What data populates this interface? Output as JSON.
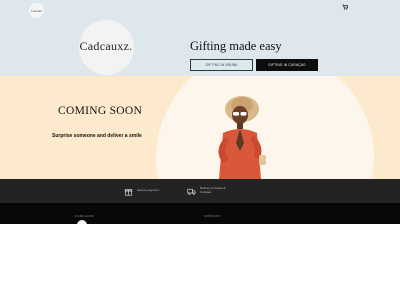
{
  "header": {
    "mini_logo_text": "Cadcaux",
    "cart_icon": "cart-icon",
    "logo_text": "Cadcauxz.",
    "tagline": "Gifting made easy",
    "buttons": {
      "primary_outline": "GIFTING IN ARUBA",
      "primary_filled": "GIFTING IN CURAÇAO"
    }
  },
  "hero": {
    "headline": "COMING SOON",
    "subheadline": "Surprise someone and deliver a smile"
  },
  "features": [
    {
      "icon": "gift-box-icon",
      "label": "Secure payment"
    },
    {
      "icon": "delivery-truck-icon",
      "label": "Delivery in Aruba & Curaçao"
    }
  ],
  "footer": {
    "heading_left": "CADCAUXZ",
    "heading_right": "CONTACT"
  },
  "colors": {
    "header_bg": "#dde7ec",
    "hero_bg": "#fde9cc",
    "strip_bg": "#232323",
    "footer_bg": "#080808",
    "button_filled": "#0d0d0d"
  }
}
